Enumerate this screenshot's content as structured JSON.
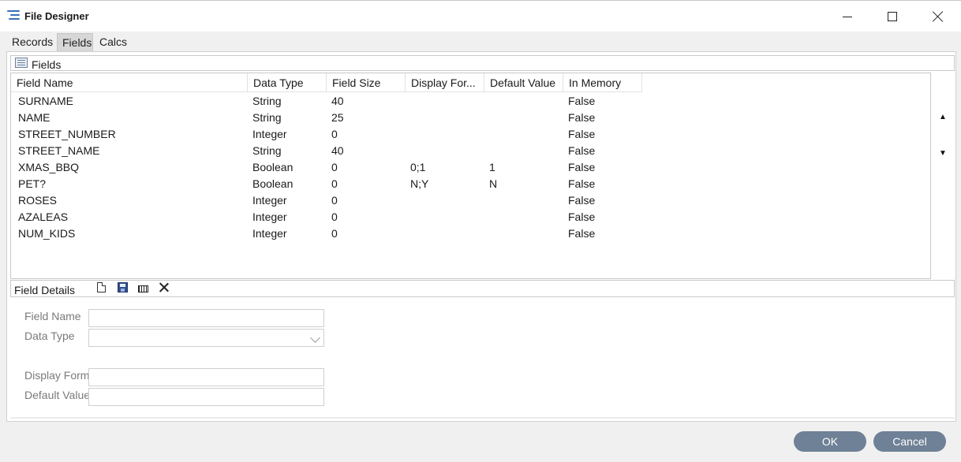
{
  "window": {
    "title": "File Designer",
    "app_icon": "app-lines-icon",
    "controls": [
      "minimize-icon",
      "maximize-icon",
      "close-icon"
    ]
  },
  "tabs": [
    {
      "label": "Records",
      "active": false
    },
    {
      "label": "Fields",
      "active": true
    },
    {
      "label": "Calcs",
      "active": false
    }
  ],
  "fields_panel": {
    "label": "Fields",
    "columns": [
      "Field Name",
      "Data Type",
      "Field Size",
      "Display For...",
      "Default Value",
      "In Memory"
    ],
    "rows": [
      [
        "SURNAME",
        "String",
        "40",
        "",
        "",
        "False"
      ],
      [
        "NAME",
        "String",
        "25",
        "",
        "",
        "False"
      ],
      [
        "STREET_NUMBER",
        "Integer",
        "0",
        "",
        "",
        "False"
      ],
      [
        "STREET_NAME",
        "String",
        "40",
        "",
        "",
        "False"
      ],
      [
        "XMAS_BBQ",
        "Boolean",
        "0",
        "0;1",
        "1",
        "False"
      ],
      [
        "PET?",
        "Boolean",
        "0",
        "N;Y",
        "N",
        "False"
      ],
      [
        "ROSES",
        "Integer",
        "0",
        "",
        "",
        "False"
      ],
      [
        "AZALEAS",
        "Integer",
        "0",
        "",
        "",
        "False"
      ],
      [
        "NUM_KIDS",
        "Integer",
        "0",
        "",
        "",
        "False"
      ]
    ]
  },
  "details_panel": {
    "label": "Field Details",
    "toolbar_icons": [
      "new-document-icon",
      "save-icon",
      "edit-icon",
      "delete-icon"
    ],
    "form": {
      "field_name_label": "Field Name",
      "field_name_value": "",
      "data_type_label": "Data Type",
      "data_type_value": "",
      "display_format_label": "Display Format",
      "display_format_value": "",
      "default_value_label": "Default Value",
      "default_value_value": ""
    }
  },
  "buttons": {
    "ok": "OK",
    "cancel": "Cancel"
  },
  "colors": {
    "button_bg": "#6f8196",
    "accent": "#3b6fb6"
  }
}
